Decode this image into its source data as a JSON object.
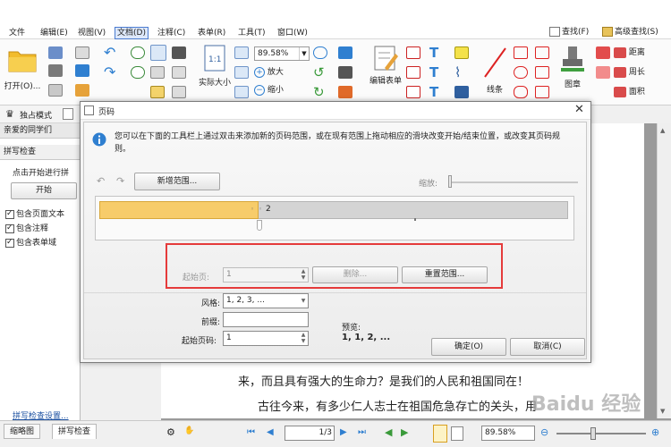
{
  "menubar": {
    "items": [
      "文件",
      "编辑(E)",
      "视图(V)",
      "文档(D)",
      "注释(C)",
      "表单(R)",
      "工具(T)",
      "窗口(W)"
    ],
    "find": "查找(F)",
    "advanced_find": "高级查找(S)"
  },
  "ribbon": {
    "open_label": "打开(O)...",
    "actual_size_label": "实际大小",
    "zoom_value": "89.58%",
    "zoom_in_label": "放大",
    "zoom_out_label": "缩小",
    "edit_form_label": "编辑表单",
    "line_label": "线条",
    "stamp_label": "图章",
    "distance_label": "距离",
    "perimeter_label": "周长",
    "area_label": "面积"
  },
  "toolbar2": {
    "exclusive_mode": "独占模式"
  },
  "left_panel": {
    "doc_tab_label": "亲爱的同学们",
    "spell_header": "拼写检查",
    "instruction": "点击开始进行拼",
    "start_button": "开始",
    "options": [
      "包含页面文本",
      "包含注释",
      "包含表单域"
    ],
    "settings_link": "拼写检查设置..."
  },
  "document": {
    "line1": "来，而且具有强大的生命力？是我们的人民和祖国同在！",
    "line2": "古往今来，有多少仁人志士在祖国危急存亡的关头，用",
    "watermark": "Baidu 经验"
  },
  "bottom": {
    "tab_thumbnails": "缩略图",
    "tab_spell": "拼写检查",
    "page_value": "1",
    "page_total": "/3",
    "zoom_value": "89.58%"
  },
  "dialog": {
    "title": "页码",
    "info_text": "您可以在下面的工具栏上通过双击来添加新的页码范围，或在现有范围上拖动相应的滑块改变开始/结束位置，或改变其页码规则。",
    "new_range_button": "新增范围...",
    "zoom_label": "缩放:",
    "range_marker": "2",
    "start_page_label": "起始页:",
    "start_page_value": "1",
    "delete_button": "删除...",
    "reset_button": "重置范围...",
    "style_label": "风格:",
    "style_value": "1, 2, 3, ...",
    "prefix_label": "前缀:",
    "prefix_value": "",
    "start_number_label": "起始页码:",
    "start_number_value": "1",
    "preview_label": "预览:",
    "preview_value": "1, 1, 2, ...",
    "ok_button": "确定(O)",
    "cancel_button": "取消(C)"
  },
  "colors": {
    "highlight_red": "#e53b3b",
    "range_bar": "#f7cc6a",
    "info_icon": "#2f7fd0"
  }
}
